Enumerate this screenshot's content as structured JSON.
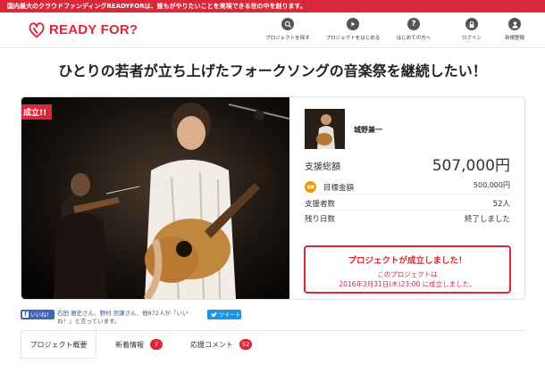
{
  "topbar": {
    "text": "国内最大のクラウドファンディングREADYFORは、誰もがやりたいことを実現できる世の中を創ります。"
  },
  "header": {
    "logo_text": "READY FOR?",
    "nav": [
      {
        "label": "プロジェクトを探す",
        "icon": "search-icon"
      },
      {
        "label": "プロジェクトをはじめる",
        "icon": "play-icon"
      },
      {
        "label": "はじめての方へ",
        "icon": "question-icon"
      },
      {
        "label": "ログイン",
        "icon": "lock-icon"
      },
      {
        "label": "新規登録",
        "icon": "user-icon"
      }
    ]
  },
  "project": {
    "title": "ひとりの若者が立ち上げたフォークソングの音楽祭を継続したい！",
    "badge": "成立!!",
    "owner_name": "城野兼一",
    "total_label": "支援総額",
    "total_value": "507,000円",
    "goal_icon_text": "目標",
    "goal_label": "目標金額",
    "goal_value": "500,000円",
    "supporters_label": "支援者数",
    "supporters_value": "52人",
    "remaining_label": "残り日数",
    "remaining_value": "終了しました",
    "success_title": "プロジェクトが成立しました！",
    "success_line1": "このプロジェクトは",
    "success_line2": "2016年3月31日(木)23:00 に成立しました。"
  },
  "social": {
    "like_label": "いいね！",
    "like_names": "石田 雅史さん、野村 崇謙さん",
    "like_rest": "、他872人が「いいね！」と言っています。",
    "tweet_label": "ツイート"
  },
  "tabs": [
    {
      "label": "プロジェクト概要",
      "count": ""
    },
    {
      "label": "新着情報",
      "count": "7"
    },
    {
      "label": "応援コメント",
      "count": "52"
    }
  ],
  "colors": {
    "brand": "#d9283a",
    "goal_icon": "#f29600",
    "facebook": "#4267b2",
    "twitter": "#1b95e0"
  }
}
